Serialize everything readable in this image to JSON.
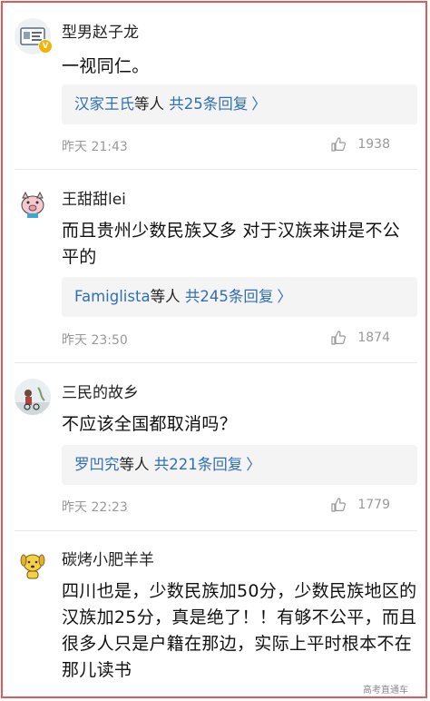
{
  "comments": [
    {
      "username": "型男赵子龙",
      "verified": true,
      "verified_mark": "V",
      "text": "一视同仁。",
      "reply_names": "汉家王氏",
      "reply_mid": "等人",
      "reply_count": "共25条回复",
      "reply_arrow": "〉",
      "time": "昨天 21:43",
      "likes": "1938",
      "avatar_icon": "badge-card-avatar-icon"
    },
    {
      "username": "王甜甜lei",
      "verified": false,
      "text": "而且贵州少数民族又多 对于汉族来讲是不公平的",
      "reply_names": "Famiglista",
      "reply_mid": "等人",
      "reply_count": "共245条回复",
      "reply_arrow": "〉",
      "time": "昨天 23:50",
      "likes": "1874",
      "avatar_icon": "cartoon-pig-avatar-icon"
    },
    {
      "username": "三民的故乡",
      "verified": false,
      "text": "不应该全国都取消吗？",
      "reply_names": "罗凹究",
      "reply_mid": "等人",
      "reply_count": "共221条回复",
      "reply_arrow": "〉",
      "time": "昨天 22:23",
      "likes": "1779",
      "avatar_icon": "illustration-avatar-icon"
    },
    {
      "username": "碳烤小肥羊羊",
      "verified": false,
      "text": "四川也是，少数民族加50分，少数民族地区的汉族加25分，真是绝了！！有够不公平，而且很多人只是户籍在那边，实际上平时根本不在那儿读书",
      "avatar_icon": "yellow-dog-avatar-icon"
    }
  ],
  "watermark": "高考直通车",
  "colors": {
    "link_blue": "#2f6fb5",
    "meta_gray": "#999999",
    "reply_bg": "#f4f4f4",
    "frame_red": "#e05a5a",
    "verified_gold": "#f3b300"
  }
}
